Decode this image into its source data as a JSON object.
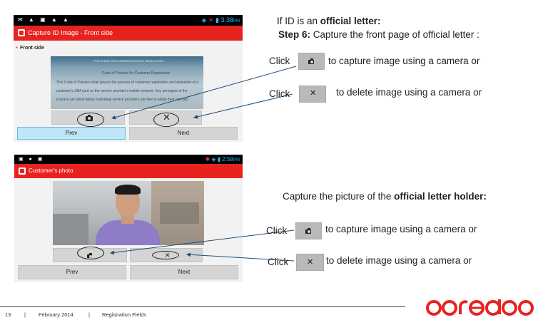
{
  "slide": {
    "heading1": "If ID is an ",
    "heading1_bold": "official letter:",
    "heading2_bold": "Step 6:",
    "heading2": " Capture the front page of official letter :",
    "click_word": "Click",
    "instr_capture": "to capture image using a camera or",
    "instr_delete": "to delete image using a camera or",
    "holder_prefix": "Capture the picture of the ",
    "holder_bold": "official letter holder:"
  },
  "phone1": {
    "status_time": "3:38",
    "status_ampm": "PM",
    "title": "Capture ID Image - Front side",
    "required_mark": "*",
    "section_label": "Front side",
    "doc_heading": "POSTS AND TELECOMMUNICATIONS REGULATORY",
    "doc_subtitle": "Code of Practice for Customer Registration",
    "doc_line1": "This Code of Practice shall govern the process of customer registration and activation of a",
    "doc_line2": "customer's SIM card on the service provider's mobile network. Key principles of the",
    "doc_line3": "practice are listed below. Individual service providers are free to adopt their own pro",
    "prev_label": "Prev",
    "next_label": "Next"
  },
  "phone2": {
    "status_time": "2:59",
    "status_ampm": "PM",
    "title": "Customer's photo",
    "prev_label": "Prev",
    "next_label": "Next"
  },
  "footer": {
    "page": "13",
    "sep": "|",
    "date": "February 2014",
    "section": "Registration Fields"
  },
  "brand": {
    "logo_text": "ooredoo",
    "color": "#e8221f"
  },
  "colors": {
    "titlebar": "#e8221f",
    "arrow": "#1f4e79",
    "button_gray": "#d4d4d4",
    "button_selected": "#bfe6f7"
  }
}
